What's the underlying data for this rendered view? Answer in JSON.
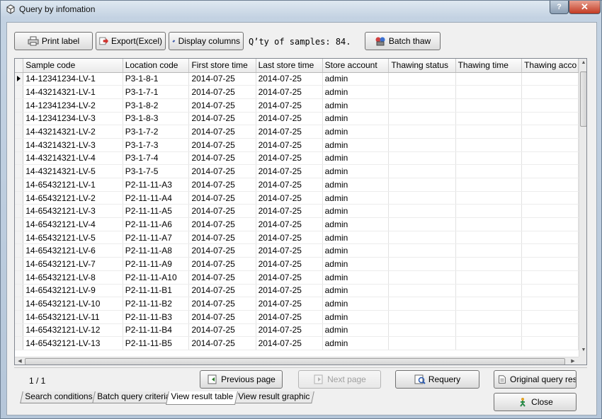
{
  "window": {
    "title": "Query by infomation",
    "help_label": "?",
    "close_label": "✕"
  },
  "toolbar": {
    "print_label": "Print label",
    "export_label": "Export(Excel)",
    "display_columns_label": "Display columns",
    "qty_text": "Q’ty of samples: 84.",
    "batch_thaw_label": "Batch thaw"
  },
  "table": {
    "columns": [
      "Sample code",
      "Location code",
      "First store time",
      "Last store time",
      "Store account",
      "Thawing status",
      "Thawing time",
      "Thawing acco"
    ],
    "rows": [
      [
        "14-12341234-LV-1",
        "P3-1-8-1",
        "2014-07-25",
        "2014-07-25",
        "admin",
        "",
        "",
        ""
      ],
      [
        "14-43214321-LV-1",
        "P3-1-7-1",
        "2014-07-25",
        "2014-07-25",
        "admin",
        "",
        "",
        ""
      ],
      [
        "14-12341234-LV-2",
        "P3-1-8-2",
        "2014-07-25",
        "2014-07-25",
        "admin",
        "",
        "",
        ""
      ],
      [
        "14-12341234-LV-3",
        "P3-1-8-3",
        "2014-07-25",
        "2014-07-25",
        "admin",
        "",
        "",
        ""
      ],
      [
        "14-43214321-LV-2",
        "P3-1-7-2",
        "2014-07-25",
        "2014-07-25",
        "admin",
        "",
        "",
        ""
      ],
      [
        "14-43214321-LV-3",
        "P3-1-7-3",
        "2014-07-25",
        "2014-07-25",
        "admin",
        "",
        "",
        ""
      ],
      [
        "14-43214321-LV-4",
        "P3-1-7-4",
        "2014-07-25",
        "2014-07-25",
        "admin",
        "",
        "",
        ""
      ],
      [
        "14-43214321-LV-5",
        "P3-1-7-5",
        "2014-07-25",
        "2014-07-25",
        "admin",
        "",
        "",
        ""
      ],
      [
        "14-65432121-LV-1",
        "P2-11-11-A3",
        "2014-07-25",
        "2014-07-25",
        "admin",
        "",
        "",
        ""
      ],
      [
        "14-65432121-LV-2",
        "P2-11-11-A4",
        "2014-07-25",
        "2014-07-25",
        "admin",
        "",
        "",
        ""
      ],
      [
        "14-65432121-LV-3",
        "P2-11-11-A5",
        "2014-07-25",
        "2014-07-25",
        "admin",
        "",
        "",
        ""
      ],
      [
        "14-65432121-LV-4",
        "P2-11-11-A6",
        "2014-07-25",
        "2014-07-25",
        "admin",
        "",
        "",
        ""
      ],
      [
        "14-65432121-LV-5",
        "P2-11-11-A7",
        "2014-07-25",
        "2014-07-25",
        "admin",
        "",
        "",
        ""
      ],
      [
        "14-65432121-LV-6",
        "P2-11-11-A8",
        "2014-07-25",
        "2014-07-25",
        "admin",
        "",
        "",
        ""
      ],
      [
        "14-65432121-LV-7",
        "P2-11-11-A9",
        "2014-07-25",
        "2014-07-25",
        "admin",
        "",
        "",
        ""
      ],
      [
        "14-65432121-LV-8",
        "P2-11-11-A10",
        "2014-07-25",
        "2014-07-25",
        "admin",
        "",
        "",
        ""
      ],
      [
        "14-65432121-LV-9",
        "P2-11-11-B1",
        "2014-07-25",
        "2014-07-25",
        "admin",
        "",
        "",
        ""
      ],
      [
        "14-65432121-LV-10",
        "P2-11-11-B2",
        "2014-07-25",
        "2014-07-25",
        "admin",
        "",
        "",
        ""
      ],
      [
        "14-65432121-LV-11",
        "P2-11-11-B3",
        "2014-07-25",
        "2014-07-25",
        "admin",
        "",
        "",
        ""
      ],
      [
        "14-65432121-LV-12",
        "P2-11-11-B4",
        "2014-07-25",
        "2014-07-25",
        "admin",
        "",
        "",
        ""
      ],
      [
        "14-65432121-LV-13",
        "P2-11-11-B5",
        "2014-07-25",
        "2014-07-25",
        "admin",
        "",
        "",
        ""
      ]
    ]
  },
  "pager": {
    "page_info": "1 / 1",
    "previous_label": "Previous page",
    "next_label": "Next page",
    "requery_label": "Requery",
    "original_label": "Original query result",
    "close_label": "Close"
  },
  "tabs": [
    {
      "label": "Search conditions",
      "active": false
    },
    {
      "label": "Batch query criteria",
      "active": false
    },
    {
      "label": "View result table",
      "active": true
    },
    {
      "label": "View result graphic",
      "active": false
    }
  ],
  "icons": {
    "window": "app-window-icon",
    "print": "printer-icon",
    "export": "export-excel-icon",
    "display_columns": "columns-icon",
    "batch_thaw": "batch-thaw-icon",
    "previous": "previous-page-icon",
    "next": "next-page-icon",
    "requery": "requery-icon",
    "original": "document-icon",
    "close": "close-person-icon"
  },
  "colors": {
    "accent": "#c23a22",
    "grid_border": "#828790",
    "window_bg": "#c4d3e3"
  }
}
